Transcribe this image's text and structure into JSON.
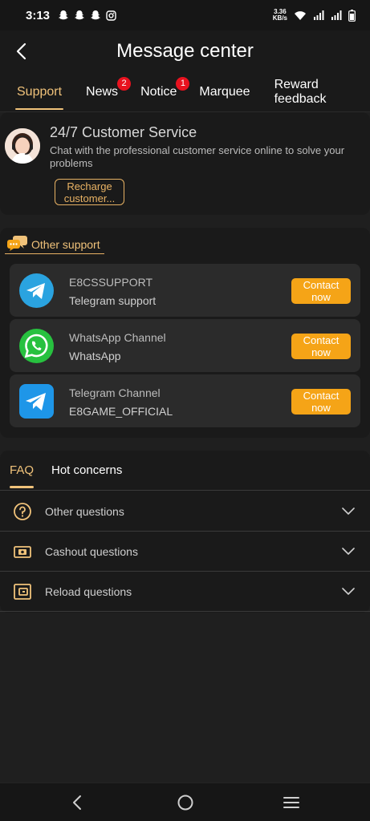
{
  "status_bar": {
    "time": "3:13",
    "net_speed_value": "3.36",
    "net_speed_unit": "KB/s"
  },
  "header": {
    "title": "Message center"
  },
  "tabs": [
    {
      "label": "Support",
      "active": true
    },
    {
      "label": "News",
      "badge": "2"
    },
    {
      "label": "Notice",
      "badge": "1"
    },
    {
      "label": "Marquee"
    },
    {
      "label": "Reward feedback"
    }
  ],
  "customer_service": {
    "title": "24/7 Customer Service",
    "description": "Chat with the professional customer service online to solve your problems",
    "recharge_label_line1": "Recharge",
    "recharge_label_line2": "customer..."
  },
  "other_support": {
    "heading": "Other support",
    "items": [
      {
        "name": "E8CSSUPPORT",
        "sub": "Telegram support",
        "icon": "telegram-round-icon",
        "button_line1": "Contact",
        "button_line2": "now"
      },
      {
        "name": "WhatsApp Channel",
        "sub": "WhatsApp",
        "icon": "whatsapp-icon",
        "button_line1": "Contact",
        "button_line2": "now"
      },
      {
        "name": "Telegram Channel",
        "sub": "E8GAME_OFFICIAL",
        "icon": "telegram-square-icon",
        "button_line1": "Contact",
        "button_line2": "now"
      }
    ]
  },
  "faq": {
    "tabs": [
      {
        "label": "FAQ",
        "active": true
      },
      {
        "label": "Hot concerns"
      }
    ],
    "rows": [
      {
        "label": "Other questions",
        "icon": "question-circle-icon"
      },
      {
        "label": "Cashout questions",
        "icon": "cash-icon"
      },
      {
        "label": "Reload questions",
        "icon": "wallet-icon"
      }
    ]
  },
  "colors": {
    "accent": "#f0c27a",
    "button": "#f5a417",
    "badge": "#e8121f",
    "background": "#1f1f1f"
  }
}
